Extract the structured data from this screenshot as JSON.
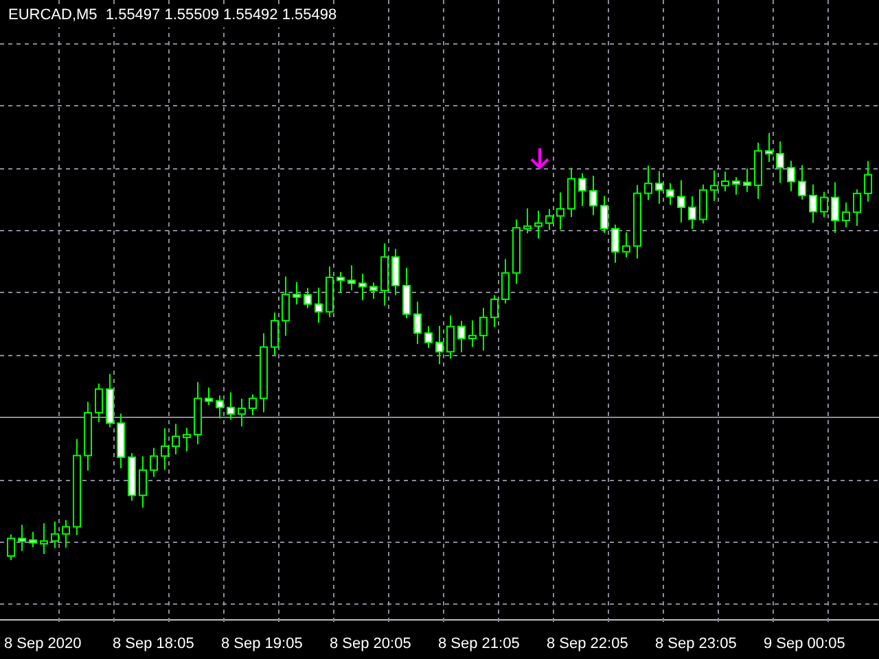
{
  "chart": {
    "header": "EURCAD,M5  1.55497 1.55509 1.55492 1.55498",
    "time_labels": [
      "8 Sep 2020",
      "8 Sep 18:05",
      "8 Sep 19:05",
      "8 Sep 20:05",
      "8 Sep 21:05",
      "8 Sep 22:05",
      "8 Sep 23:05",
      "9 Sep 00:05"
    ]
  }
}
